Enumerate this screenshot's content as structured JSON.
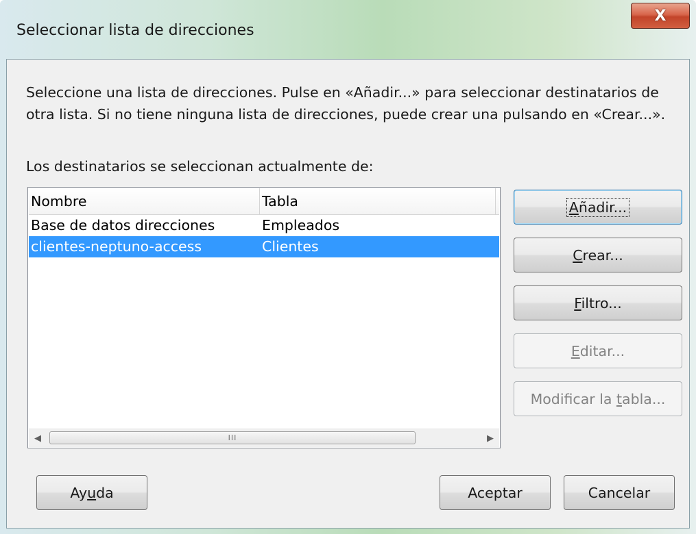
{
  "window": {
    "title": "Seleccionar lista de direcciones",
    "close_label": "X"
  },
  "description": {
    "line1": "Seleccione una lista de direcciones. Pulse en «Añadir...» para seleccionar destinatarios de",
    "line2": "otra lista. Si no tiene ninguna lista de direcciones, puede crear una pulsando en «Crear...»."
  },
  "source_label": "Los destinatarios se seleccionan actualmente de:",
  "list": {
    "columns": [
      "Nombre",
      "Tabla"
    ],
    "rows": [
      {
        "name": "Base de datos direcciones",
        "table": "Empleados",
        "selected": false
      },
      {
        "name": "clientes-neptuno-access",
        "table": "Clientes",
        "selected": true
      }
    ],
    "scroll_grip": "III"
  },
  "side_buttons": {
    "add": {
      "pre": "",
      "mnemonic": "A",
      "post": "ñadir...",
      "enabled": true,
      "default": true
    },
    "create": {
      "pre": "",
      "mnemonic": "C",
      "post": "rear...",
      "enabled": true
    },
    "filter": {
      "pre": "",
      "mnemonic": "F",
      "post": "iltro...",
      "enabled": true
    },
    "edit": {
      "pre": "",
      "mnemonic": "E",
      "post": "ditar...",
      "enabled": false
    },
    "modify": {
      "pre": "Modificar la ",
      "mnemonic": "t",
      "post": "abla...",
      "enabled": false
    }
  },
  "bottom_buttons": {
    "help": {
      "pre": "Ay",
      "mnemonic": "u",
      "post": "da"
    },
    "ok": "Aceptar",
    "cancel": "Cancelar"
  }
}
